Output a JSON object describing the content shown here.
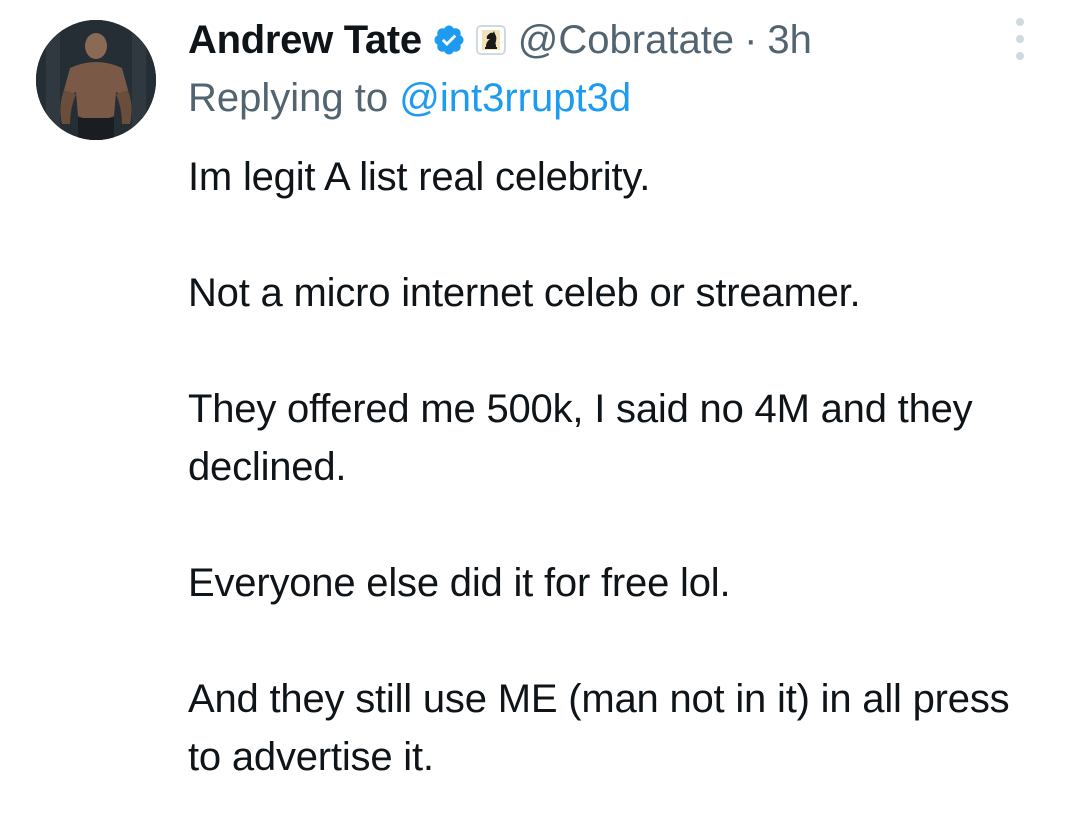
{
  "tweet": {
    "author": {
      "display_name": "Andrew Tate",
      "verified_icon": "verified-badge-icon",
      "affiliate_icon": "chess-knight-icon",
      "handle": "@Cobratate",
      "separator": "·",
      "time": "3h"
    },
    "reply": {
      "prefix": "Replying to ",
      "to_handle": "@int3rrupt3d"
    },
    "body": {
      "line1": "Im legit A list real celebrity.",
      "line2": "Not a micro internet celeb or streamer.",
      "line3": "They offered me 500k, I said no 4M and they declined.",
      "line4": "Everyone else did it for free lol.",
      "line5": "And they still use ME (man not in it) in all press to advertise it."
    },
    "more_icon": "more-vertical-icon",
    "colors": {
      "text": "#0f1419",
      "secondary": "#536471",
      "link": "#1d9bf0",
      "verified": "#1d9bf0"
    }
  }
}
